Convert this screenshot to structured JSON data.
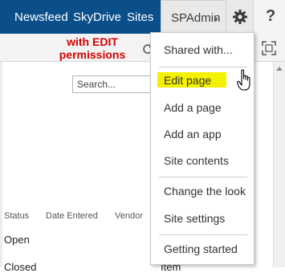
{
  "suitebar": {
    "links": [
      "Newsfeed",
      "SkyDrive",
      "Sites"
    ],
    "user": "SPAdmin",
    "user_caret": "▾",
    "help": "?",
    "background_color": "#0b4f8a"
  },
  "annotation": {
    "text": "with EDIT permissions",
    "color": "#d40000"
  },
  "search": {
    "placeholder": "Search..."
  },
  "list": {
    "columns": [
      "Status",
      "Date Entered",
      "Vendor"
    ],
    "rows": [
      {
        "status": "Open"
      },
      {
        "status": "Closed",
        "extra": "Item"
      }
    ]
  },
  "settings_menu": {
    "items": [
      "Shared with...",
      "Edit page",
      "Add a page",
      "Add an app",
      "Site contents",
      "Change the look",
      "Site settings",
      "Getting started"
    ],
    "highlighted_item": "Edit page",
    "highlight_color": "#f3f000"
  },
  "icons": [
    "gear-icon",
    "help-icon",
    "sync-icon",
    "focus-icon",
    "hand-cursor-icon"
  ]
}
